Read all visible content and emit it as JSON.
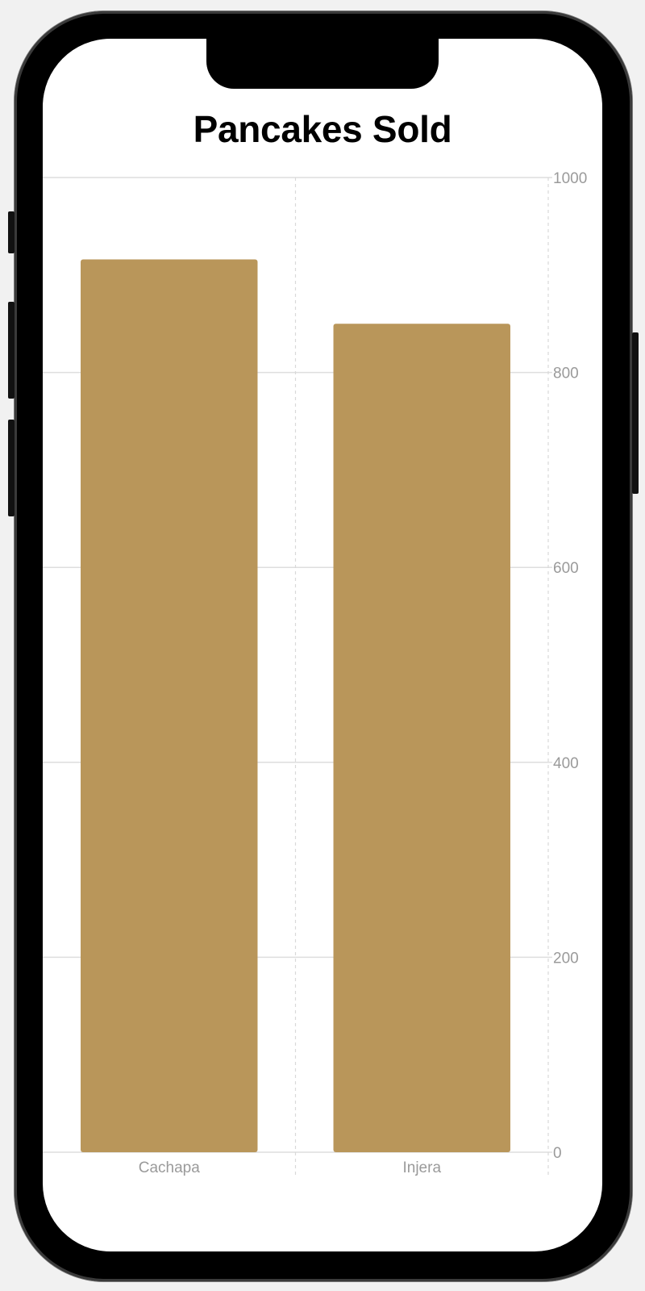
{
  "screen": {
    "background": "#ffffff"
  },
  "chart_data": {
    "type": "bar",
    "title": "Pancakes Sold",
    "categories": [
      "Cachapa",
      "Injera"
    ],
    "values": [
      916,
      850
    ],
    "ylim": [
      0,
      1000
    ],
    "yticks": [
      0,
      200,
      400,
      600,
      800,
      1000
    ],
    "yaxis_position": "right",
    "grid": true,
    "bar_color": "#b9965a",
    "xlabel": "",
    "ylabel": ""
  }
}
